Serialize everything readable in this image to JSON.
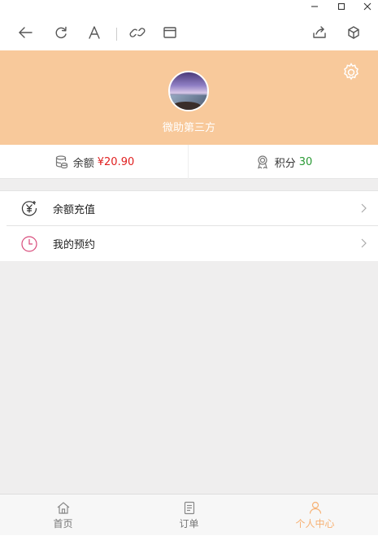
{
  "toolbar": {
    "icons": [
      "back-icon",
      "refresh-icon",
      "font-icon",
      "link-icon",
      "window-icon",
      "share-icon",
      "cube-icon"
    ]
  },
  "profile": {
    "name": "微助第三方",
    "header_color": "#f8c99b"
  },
  "balance": {
    "label": "余额",
    "value": "¥20.90"
  },
  "points": {
    "label": "积分",
    "value": "30"
  },
  "menu": [
    {
      "label": "余额充值",
      "icon": "yuan-recharge-icon"
    },
    {
      "label": "我的预约",
      "icon": "clock-icon"
    }
  ],
  "tabs": [
    {
      "label": "首页",
      "icon": "home-icon",
      "active": false
    },
    {
      "label": "订单",
      "icon": "order-icon",
      "active": false
    },
    {
      "label": "个人中心",
      "icon": "user-icon",
      "active": true
    }
  ],
  "colors": {
    "accent": "#f7b173",
    "balance": "#e02020",
    "points": "#2a9a35"
  }
}
